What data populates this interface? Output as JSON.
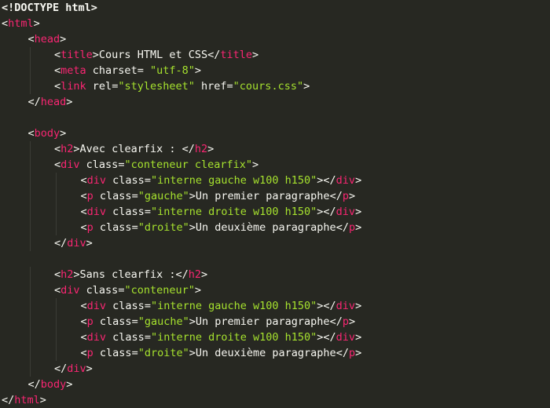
{
  "editor": {
    "colors": {
      "background": "#272822",
      "tag_bracket": "#f8f8f2",
      "tag_name": "#f92672",
      "attr_value": "#a6e22e",
      "text": "#f8f8f2"
    },
    "lines": [
      {
        "indent": 0,
        "tokens": [
          {
            "t": "doc",
            "v": "<!DOCTYPE html>"
          }
        ]
      },
      {
        "indent": 0,
        "tokens": [
          {
            "t": "tag",
            "v": "<"
          },
          {
            "t": "name",
            "v": "html"
          },
          {
            "t": "tag",
            "v": ">"
          }
        ]
      },
      {
        "indent": 1,
        "tokens": [
          {
            "t": "tag",
            "v": "<"
          },
          {
            "t": "name",
            "v": "head"
          },
          {
            "t": "tag",
            "v": ">"
          }
        ]
      },
      {
        "indent": 2,
        "tokens": [
          {
            "t": "tag",
            "v": "<"
          },
          {
            "t": "name",
            "v": "title"
          },
          {
            "t": "tag",
            "v": ">"
          },
          {
            "t": "txt",
            "v": "Cours HTML et CSS"
          },
          {
            "t": "tag",
            "v": "</"
          },
          {
            "t": "name",
            "v": "title"
          },
          {
            "t": "tag",
            "v": ">"
          }
        ]
      },
      {
        "indent": 2,
        "tokens": [
          {
            "t": "tag",
            "v": "<"
          },
          {
            "t": "name",
            "v": "meta"
          },
          {
            "t": "txt",
            "v": " "
          },
          {
            "t": "attrn",
            "v": "charset"
          },
          {
            "t": "txt",
            "v": "= "
          },
          {
            "t": "str",
            "v": "\"utf-8\""
          },
          {
            "t": "tag",
            "v": ">"
          }
        ]
      },
      {
        "indent": 2,
        "tokens": [
          {
            "t": "tag",
            "v": "<"
          },
          {
            "t": "name",
            "v": "link"
          },
          {
            "t": "txt",
            "v": " "
          },
          {
            "t": "attrn",
            "v": "rel"
          },
          {
            "t": "txt",
            "v": "="
          },
          {
            "t": "str",
            "v": "\"stylesheet\""
          },
          {
            "t": "txt",
            "v": " "
          },
          {
            "t": "attrn",
            "v": "href"
          },
          {
            "t": "txt",
            "v": "="
          },
          {
            "t": "str",
            "v": "\"cours.css\""
          },
          {
            "t": "tag",
            "v": ">"
          }
        ]
      },
      {
        "indent": 1,
        "tokens": [
          {
            "t": "tag",
            "v": "</"
          },
          {
            "t": "name",
            "v": "head"
          },
          {
            "t": "tag",
            "v": ">"
          }
        ]
      },
      {
        "indent": 0,
        "tokens": []
      },
      {
        "indent": 1,
        "tokens": [
          {
            "t": "tag",
            "v": "<"
          },
          {
            "t": "name",
            "v": "body"
          },
          {
            "t": "tag",
            "v": ">"
          }
        ]
      },
      {
        "indent": 2,
        "tokens": [
          {
            "t": "tag",
            "v": "<"
          },
          {
            "t": "name",
            "v": "h2"
          },
          {
            "t": "tag",
            "v": ">"
          },
          {
            "t": "txt",
            "v": "Avec clearfix : "
          },
          {
            "t": "tag",
            "v": "</"
          },
          {
            "t": "name",
            "v": "h2"
          },
          {
            "t": "tag",
            "v": ">"
          }
        ]
      },
      {
        "indent": 2,
        "tokens": [
          {
            "t": "tag",
            "v": "<"
          },
          {
            "t": "name",
            "v": "div"
          },
          {
            "t": "txt",
            "v": " "
          },
          {
            "t": "attrn",
            "v": "class"
          },
          {
            "t": "txt",
            "v": "="
          },
          {
            "t": "str",
            "v": "\"conteneur clearfix\""
          },
          {
            "t": "tag",
            "v": ">"
          }
        ]
      },
      {
        "indent": 3,
        "tokens": [
          {
            "t": "tag",
            "v": "<"
          },
          {
            "t": "name",
            "v": "div"
          },
          {
            "t": "txt",
            "v": " "
          },
          {
            "t": "attrn",
            "v": "class"
          },
          {
            "t": "txt",
            "v": "="
          },
          {
            "t": "str",
            "v": "\"interne gauche w100 h150\""
          },
          {
            "t": "tag",
            "v": "></"
          },
          {
            "t": "name",
            "v": "div"
          },
          {
            "t": "tag",
            "v": ">"
          }
        ]
      },
      {
        "indent": 3,
        "tokens": [
          {
            "t": "tag",
            "v": "<"
          },
          {
            "t": "name",
            "v": "p"
          },
          {
            "t": "txt",
            "v": " "
          },
          {
            "t": "attrn",
            "v": "class"
          },
          {
            "t": "txt",
            "v": "="
          },
          {
            "t": "str",
            "v": "\"gauche\""
          },
          {
            "t": "tag",
            "v": ">"
          },
          {
            "t": "txt",
            "v": "Un premier paragraphe"
          },
          {
            "t": "tag",
            "v": "</"
          },
          {
            "t": "name",
            "v": "p"
          },
          {
            "t": "tag",
            "v": ">"
          }
        ]
      },
      {
        "indent": 3,
        "tokens": [
          {
            "t": "tag",
            "v": "<"
          },
          {
            "t": "name",
            "v": "div"
          },
          {
            "t": "txt",
            "v": " "
          },
          {
            "t": "attrn",
            "v": "class"
          },
          {
            "t": "txt",
            "v": "="
          },
          {
            "t": "str",
            "v": "\"interne droite w100 h150\""
          },
          {
            "t": "tag",
            "v": "></"
          },
          {
            "t": "name",
            "v": "div"
          },
          {
            "t": "tag",
            "v": ">"
          }
        ]
      },
      {
        "indent": 3,
        "tokens": [
          {
            "t": "tag",
            "v": "<"
          },
          {
            "t": "name",
            "v": "p"
          },
          {
            "t": "txt",
            "v": " "
          },
          {
            "t": "attrn",
            "v": "class"
          },
          {
            "t": "txt",
            "v": "="
          },
          {
            "t": "str",
            "v": "\"droite\""
          },
          {
            "t": "tag",
            "v": ">"
          },
          {
            "t": "txt",
            "v": "Un deuxième paragraphe"
          },
          {
            "t": "tag",
            "v": "</"
          },
          {
            "t": "name",
            "v": "p"
          },
          {
            "t": "tag",
            "v": ">"
          }
        ]
      },
      {
        "indent": 2,
        "tokens": [
          {
            "t": "tag",
            "v": "</"
          },
          {
            "t": "name",
            "v": "div"
          },
          {
            "t": "tag",
            "v": ">"
          }
        ]
      },
      {
        "indent": 0,
        "tokens": []
      },
      {
        "indent": 2,
        "tokens": [
          {
            "t": "tag",
            "v": "<"
          },
          {
            "t": "name",
            "v": "h2"
          },
          {
            "t": "tag",
            "v": ">"
          },
          {
            "t": "txt",
            "v": "Sans clearfix :"
          },
          {
            "t": "tag",
            "v": "</"
          },
          {
            "t": "name",
            "v": "h2"
          },
          {
            "t": "tag",
            "v": ">"
          }
        ]
      },
      {
        "indent": 2,
        "tokens": [
          {
            "t": "tag",
            "v": "<"
          },
          {
            "t": "name",
            "v": "div"
          },
          {
            "t": "txt",
            "v": " "
          },
          {
            "t": "attrn",
            "v": "class"
          },
          {
            "t": "txt",
            "v": "="
          },
          {
            "t": "str",
            "v": "\"conteneur\""
          },
          {
            "t": "tag",
            "v": ">"
          }
        ]
      },
      {
        "indent": 3,
        "tokens": [
          {
            "t": "tag",
            "v": "<"
          },
          {
            "t": "name",
            "v": "div"
          },
          {
            "t": "txt",
            "v": " "
          },
          {
            "t": "attrn",
            "v": "class"
          },
          {
            "t": "txt",
            "v": "="
          },
          {
            "t": "str",
            "v": "\"interne gauche w100 h150\""
          },
          {
            "t": "tag",
            "v": "></"
          },
          {
            "t": "name",
            "v": "div"
          },
          {
            "t": "tag",
            "v": ">"
          }
        ]
      },
      {
        "indent": 3,
        "tokens": [
          {
            "t": "tag",
            "v": "<"
          },
          {
            "t": "name",
            "v": "p"
          },
          {
            "t": "txt",
            "v": " "
          },
          {
            "t": "attrn",
            "v": "class"
          },
          {
            "t": "txt",
            "v": "="
          },
          {
            "t": "str",
            "v": "\"gauche\""
          },
          {
            "t": "tag",
            "v": ">"
          },
          {
            "t": "txt",
            "v": "Un premier paragraphe"
          },
          {
            "t": "tag",
            "v": "</"
          },
          {
            "t": "name",
            "v": "p"
          },
          {
            "t": "tag",
            "v": ">"
          }
        ]
      },
      {
        "indent": 3,
        "tokens": [
          {
            "t": "tag",
            "v": "<"
          },
          {
            "t": "name",
            "v": "div"
          },
          {
            "t": "txt",
            "v": " "
          },
          {
            "t": "attrn",
            "v": "class"
          },
          {
            "t": "txt",
            "v": "="
          },
          {
            "t": "str",
            "v": "\"interne droite w100 h150\""
          },
          {
            "t": "tag",
            "v": "></"
          },
          {
            "t": "name",
            "v": "div"
          },
          {
            "t": "tag",
            "v": ">"
          }
        ]
      },
      {
        "indent": 3,
        "tokens": [
          {
            "t": "tag",
            "v": "<"
          },
          {
            "t": "name",
            "v": "p"
          },
          {
            "t": "txt",
            "v": " "
          },
          {
            "t": "attrn",
            "v": "class"
          },
          {
            "t": "txt",
            "v": "="
          },
          {
            "t": "str",
            "v": "\"droite\""
          },
          {
            "t": "tag",
            "v": ">"
          },
          {
            "t": "txt",
            "v": "Un deuxième paragraphe"
          },
          {
            "t": "tag",
            "v": "</"
          },
          {
            "t": "name",
            "v": "p"
          },
          {
            "t": "tag",
            "v": ">"
          }
        ]
      },
      {
        "indent": 2,
        "tokens": [
          {
            "t": "tag",
            "v": "</"
          },
          {
            "t": "name",
            "v": "div"
          },
          {
            "t": "tag",
            "v": ">"
          }
        ]
      },
      {
        "indent": 1,
        "tokens": [
          {
            "t": "tag",
            "v": "</"
          },
          {
            "t": "name",
            "v": "body"
          },
          {
            "t": "tag",
            "v": ">"
          }
        ]
      },
      {
        "indent": 0,
        "tokens": [
          {
            "t": "tag",
            "v": "</"
          },
          {
            "t": "name",
            "v": "html"
          },
          {
            "t": "tag",
            "v": ">"
          }
        ]
      }
    ]
  }
}
